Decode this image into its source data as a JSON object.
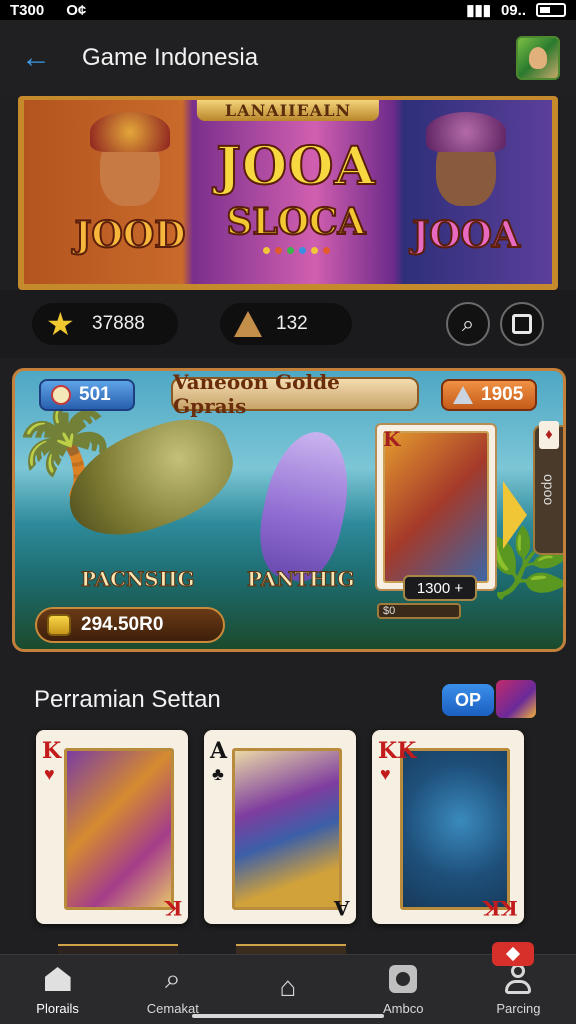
{
  "status_bar": {
    "time": "T300",
    "left_icons": "O¢",
    "right_text": "09.."
  },
  "header": {
    "back_icon": "arrow-left-icon",
    "title": "Game Indonesia",
    "avatar_icon": "user-avatar-icon"
  },
  "hero": {
    "banner_title": "LANAIIEALN",
    "panels": [
      {
        "word": "JOOD"
      },
      {
        "word_top": "JOOA",
        "word_bottom": "SLOCA"
      },
      {
        "word": "JOOA"
      }
    ]
  },
  "stats": {
    "stars": "37888",
    "gems": "132",
    "search_icon": "search-icon",
    "window_icon": "window-icon"
  },
  "game_card": {
    "badge_left": "501",
    "title": "Vaneoon Golde Gprais",
    "badge_right": "1905",
    "fish_left_label": "PACNSIIG",
    "fish_right_label": "PANTHIG",
    "prize_value": "1300 +",
    "prize_bar_text": "$0",
    "coins": "294.50R0",
    "side_tab": "opoo"
  },
  "section": {
    "title": "Perramian Settan",
    "badge": "OP",
    "cards": [
      {
        "rank": "K",
        "suit": "♥",
        "color": "#c21b1b"
      },
      {
        "rank": "A",
        "suit": "♣",
        "color": "#141414"
      },
      {
        "rank": "KK",
        "suit": "♥",
        "color": "#c21b1b"
      }
    ]
  },
  "bottom_nav": {
    "items": [
      {
        "label": "Plorails",
        "icon": "home-icon"
      },
      {
        "label": "Cemakat",
        "icon": "search-icon"
      },
      {
        "label": "",
        "icon": "home-outline-icon"
      },
      {
        "label": "Ambco",
        "icon": "box-icon"
      },
      {
        "label": "Parcing",
        "icon": "person-icon"
      }
    ]
  },
  "colors": {
    "accent": "#3d9be9",
    "background": "#1f1f21",
    "gold": "#c58a2c"
  }
}
